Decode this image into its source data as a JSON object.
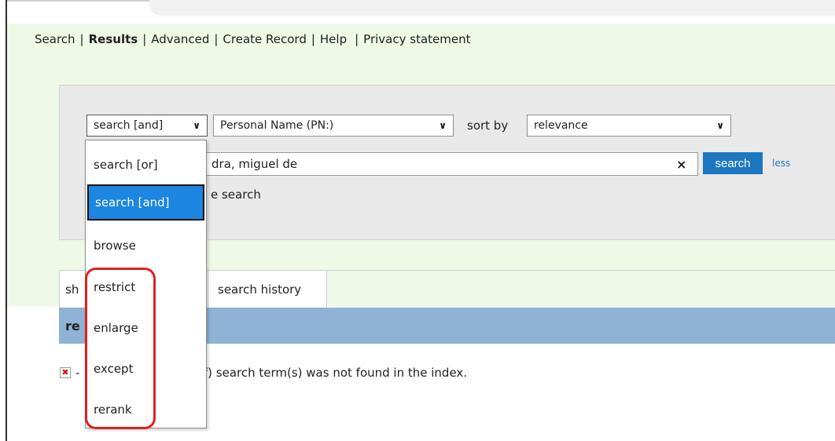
{
  "nav": {
    "items": [
      "Search",
      "Results",
      "Advanced",
      "Create Record",
      "Help",
      "Privacy statement"
    ],
    "separator": "|"
  },
  "search": {
    "operator_selected": "search [and]",
    "field_selected": "Personal Name (PN:)",
    "sort_label": "sort by",
    "sort_selected": "relevance",
    "query_visible": "dra, miguel de",
    "clear_glyph": "×",
    "button_label": "search",
    "less_link": "less",
    "subtext_visible": "e search"
  },
  "dropdown": {
    "options": [
      "search [or]",
      "search [and]",
      "browse",
      "restrict",
      "enlarge",
      "except",
      "rerank"
    ],
    "selected_index": 1,
    "highlight_color": "#e01f1f"
  },
  "tabs": {
    "shown_visible": "sh",
    "history": "search history"
  },
  "results": {
    "header_visible": "re"
  },
  "message": {
    "icon": "error-x-icon",
    "dash": "-",
    "text_visible": "n of) search term(s) was not found in the index."
  },
  "colors": {
    "page_bg": "#eef9e6",
    "accent": "#1c76c0",
    "results_bar": "#8fb2d5"
  }
}
